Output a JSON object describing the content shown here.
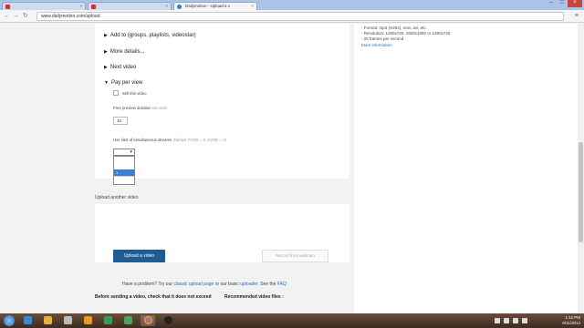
{
  "browser": {
    "tabs": [
      {
        "label": ""
      },
      {
        "label": ""
      },
      {
        "label": "Dailymotion - Upload a v"
      }
    ],
    "url": "www.dailymotion.com/upload"
  },
  "sections": {
    "add_to": "Add to (groups, playlists, videostar)",
    "more_details": "More details...",
    "next_video": "Next video",
    "pay_per_view": "Pay per view"
  },
  "ppv": {
    "sell_label": "Sell this video",
    "preview_label": "Free preview duration",
    "preview_hint": "seconds",
    "preview_value": "10",
    "streams_label": "Use limit of simultaneous streams",
    "streams_hint": "(Default TVOD = 0, SVOD = 0)",
    "streams_selected": "",
    "dropdown_options": [
      "",
      "",
      "1",
      ""
    ]
  },
  "upload": {
    "title": "Upload another video",
    "upload_button": "Upload a video",
    "record_button": "Record from webcam",
    "help_prefix": "Have a problem? Try our",
    "help_link1": "classic upload page",
    "help_mid": "or our basic",
    "help_link2": "uploader",
    "help_suffix": ". See the",
    "help_link3": "FAQ",
    "bottom_left": "Before sending a video, check that it does not exceed",
    "bottom_right": "Recommended video files :"
  },
  "sidebar": {
    "line1": "- Format: mp4 (H264), mov, avi, etc.",
    "line2": "- Resolution: 1280x720, 1920x1080 or 1280x720",
    "line3": "- 25 frames per second",
    "more_info": "More information"
  },
  "taskbar": {
    "time": "1:12 PM",
    "date": "6/11/2014"
  },
  "colors": {
    "accent": "#1f5c93",
    "link": "#2a6cb8",
    "highlight": "#3a7fd5"
  }
}
